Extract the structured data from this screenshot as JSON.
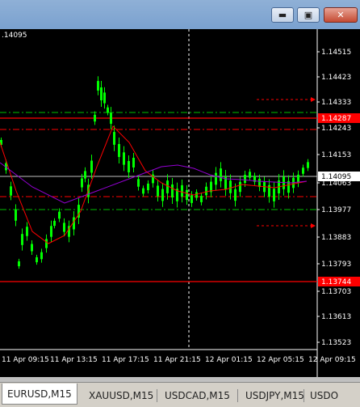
{
  "window": {
    "buttons": {
      "minimize": "▬",
      "maximize": "▣",
      "close": "✕"
    }
  },
  "chart": {
    "symbol_label": ".14095",
    "price_scale": [
      "1.14515",
      "1.14423",
      "1.14333",
      "1.14243",
      "1.14153",
      "1.14063",
      "1.13977",
      "1.13883",
      "1.13793",
      "1.13703",
      "1.13613",
      "1.13523"
    ],
    "time_scale": [
      "11 Apr 09:15",
      "11 Apr 13:15",
      "11 Apr 17:15",
      "11 Apr 21:15",
      "12 Apr 01:15",
      "12 Apr 05:15",
      "12 Apr 09:15"
    ],
    "current_price": "1.14095",
    "red_level_high": "1.14287",
    "red_level_low": "1.13744",
    "colors": {
      "background": "#000000",
      "candles": "#00ff00",
      "ma_fast": "#ff0000",
      "ma_slow": "#9400d3",
      "grid_green": "#00c000",
      "red_level": "#ff0000"
    }
  },
  "tabs": [
    {
      "label": "EURUSD,M15",
      "active": true
    },
    {
      "label": "XAUUSD,M15",
      "active": false
    },
    {
      "label": "USDCAD,M15",
      "active": false
    },
    {
      "label": "USDJPY,M15",
      "active": false
    },
    {
      "label": "USDO",
      "active": false
    }
  ]
}
